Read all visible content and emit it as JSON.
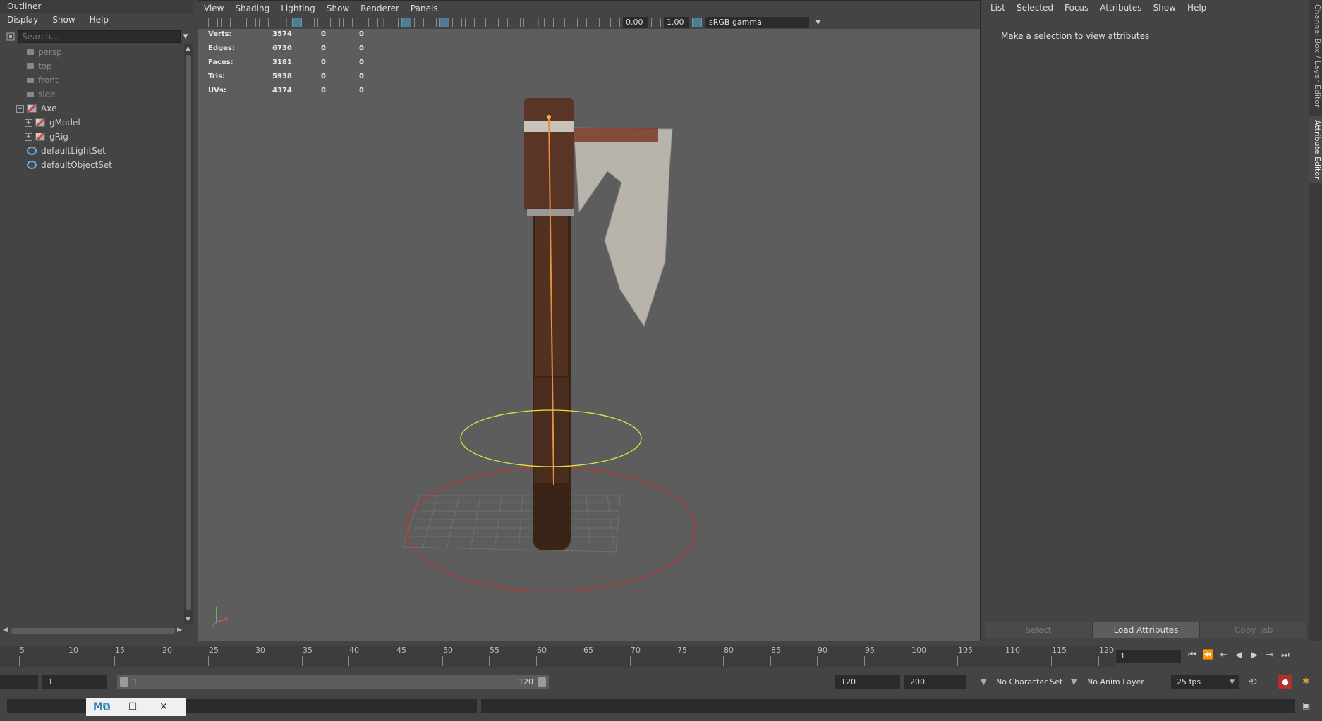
{
  "outliner": {
    "title": "Outliner",
    "menu": [
      "Display",
      "Show",
      "Help"
    ],
    "search_placeholder": "Search...",
    "items": [
      {
        "label": "persp",
        "type": "camera"
      },
      {
        "label": "top",
        "type": "camera"
      },
      {
        "label": "front",
        "type": "camera"
      },
      {
        "label": "side",
        "type": "camera"
      },
      {
        "label": "Axe",
        "type": "group"
      },
      {
        "label": "gModel",
        "type": "group"
      },
      {
        "label": "gRig",
        "type": "group"
      },
      {
        "label": "defaultLightSet",
        "type": "set"
      },
      {
        "label": "defaultObjectSet",
        "type": "set"
      }
    ]
  },
  "viewport": {
    "menu": [
      "View",
      "Shading",
      "Lighting",
      "Show",
      "Renderer",
      "Panels"
    ],
    "exposure": "0.00",
    "gamma": "1.00",
    "color_space": "sRGB gamma",
    "hud": [
      {
        "label": "Verts:",
        "v1": "3574",
        "v2": "0",
        "v3": "0"
      },
      {
        "label": "Edges:",
        "v1": "6730",
        "v2": "0",
        "v3": "0"
      },
      {
        "label": "Faces:",
        "v1": "3181",
        "v2": "0",
        "v3": "0"
      },
      {
        "label": "Tris:",
        "v1": "5938",
        "v2": "0",
        "v3": "0"
      },
      {
        "label": "UVs:",
        "v1": "4374",
        "v2": "0",
        "v3": "0"
      }
    ]
  },
  "attribute_editor": {
    "menu": [
      "List",
      "Selected",
      "Focus",
      "Attributes",
      "Show",
      "Help"
    ],
    "message": "Make a selection to view attributes",
    "buttons": {
      "select": "Select",
      "load": "Load Attributes",
      "copy": "Copy Tab"
    },
    "side_tabs": {
      "channel": "Channel Box / Layer Editor",
      "attr": "Attribute Editor"
    }
  },
  "timeline": {
    "ticks": [
      "5",
      "10",
      "15",
      "20",
      "25",
      "30",
      "35",
      "40",
      "45",
      "50",
      "55",
      "60",
      "65",
      "70",
      "75",
      "80",
      "85",
      "90",
      "95",
      "100",
      "105",
      "110",
      "115",
      "120"
    ],
    "current_frame": "1",
    "playback_controls": [
      "go-start",
      "step-back-key",
      "step-back",
      "play-back",
      "play-forward",
      "step-forward-key",
      "go-end"
    ]
  },
  "range": {
    "start": "1",
    "slider_start": "1",
    "slider_end": "120",
    "end": "120",
    "anim_end": "200",
    "character_set": "No Character Set",
    "anim_layer": "No Anim Layer",
    "fps": "25 fps"
  },
  "colors": {
    "accent": "#5285a6",
    "ring_yellow": "#e0e040",
    "ring_red": "#c03030",
    "joint_orange": "#e89040"
  }
}
